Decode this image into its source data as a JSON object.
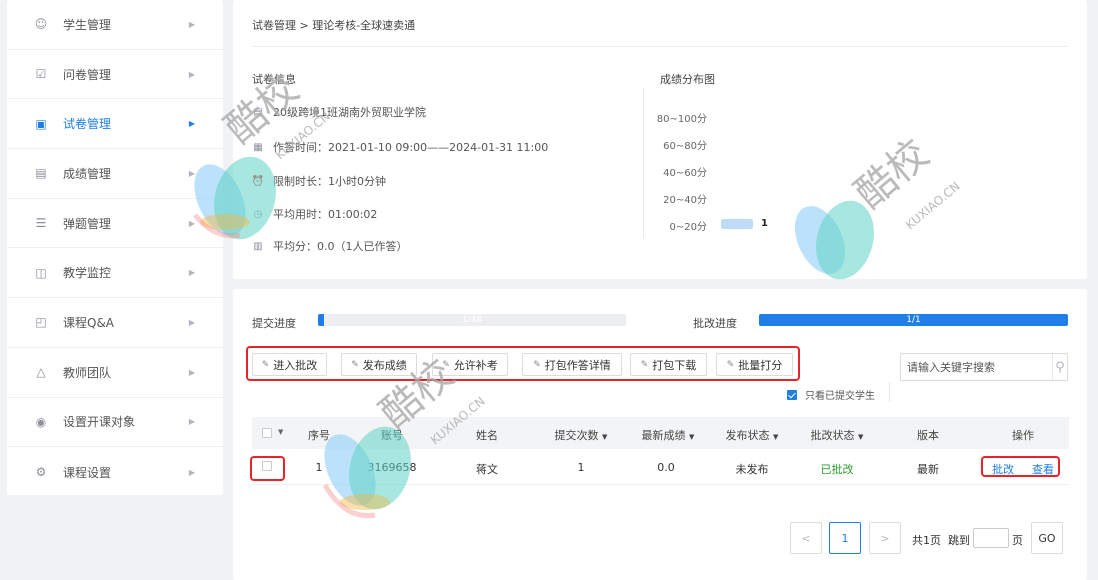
{
  "sidebar": {
    "items": [
      {
        "label": "学生管理",
        "icon": "student-icon"
      },
      {
        "label": "问卷管理",
        "icon": "survey-icon"
      },
      {
        "label": "试卷管理",
        "icon": "exam-icon"
      },
      {
        "label": "成绩管理",
        "icon": "grade-icon"
      },
      {
        "label": "弹题管理",
        "icon": "popup-question-icon"
      },
      {
        "label": "教学监控",
        "icon": "monitor-icon"
      },
      {
        "label": "课程Q&A",
        "icon": "qa-icon"
      },
      {
        "label": "教师团队",
        "icon": "team-icon"
      },
      {
        "label": "设置开课对象",
        "icon": "target-icon"
      },
      {
        "label": "课程设置",
        "icon": "settings-icon"
      }
    ],
    "active_index": 2
  },
  "breadcrumb": "试卷管理 > 理论考核-全球速卖通",
  "info": {
    "title": "试卷信息",
    "class": "20级跨境1班湖南外贸职业学院",
    "time": "作答时间：2021-01-10 09:00——2024-01-31 11:00",
    "duration": "限制时长：1小时0分钟",
    "avg_time": "平均用时：01:00:02",
    "avg_score": "平均分：0.0（1人已作答）"
  },
  "distribution": {
    "title": "成绩分布图",
    "rows": [
      {
        "label": "80~100分",
        "value": null
      },
      {
        "label": "60~80分",
        "value": null
      },
      {
        "label": "40~60分",
        "value": null
      },
      {
        "label": "20~40分",
        "value": null
      },
      {
        "label": "0~20分",
        "value": 1
      }
    ]
  },
  "progress": {
    "submit_label": "提交进度",
    "submit_text": "1/48",
    "submit_fraction": 0.0208,
    "review_label": "批改进度",
    "review_text": "1/1",
    "review_fraction": 1.0
  },
  "toolbar": {
    "start_review": "进入批改",
    "publish": "发布成绩",
    "allow_retake": "允许补考",
    "pack_details": "打包作答详情",
    "pack_download": "打包下载",
    "batch_score": "批量打分"
  },
  "search": {
    "placeholder": "请输入关键字搜索"
  },
  "only_submitted": "只看已提交学生",
  "table": {
    "headers": [
      "序号",
      "账号",
      "姓名",
      "提交次数",
      "最新成绩",
      "发布状态",
      "批改状态",
      "版本",
      "操作"
    ],
    "rows": [
      {
        "index": "1",
        "account": "3169658",
        "name": "蒋文",
        "submits": "1",
        "score": "0.0",
        "publish": "未发布",
        "review": "已批改",
        "version": "最新",
        "action_review": "批改",
        "action_view": "查看"
      }
    ]
  },
  "pager": {
    "prev": "<",
    "current": "1",
    "next": ">",
    "total": "共1页",
    "jump": "跳到",
    "page_unit": "页",
    "go": "GO"
  },
  "watermark": {
    "brand": "酷校",
    "domain": "KUXIAO.CN"
  },
  "colors": {
    "accent": "#1e7fe8",
    "highlight": "#e4262b",
    "success": "#2a9d2a"
  }
}
